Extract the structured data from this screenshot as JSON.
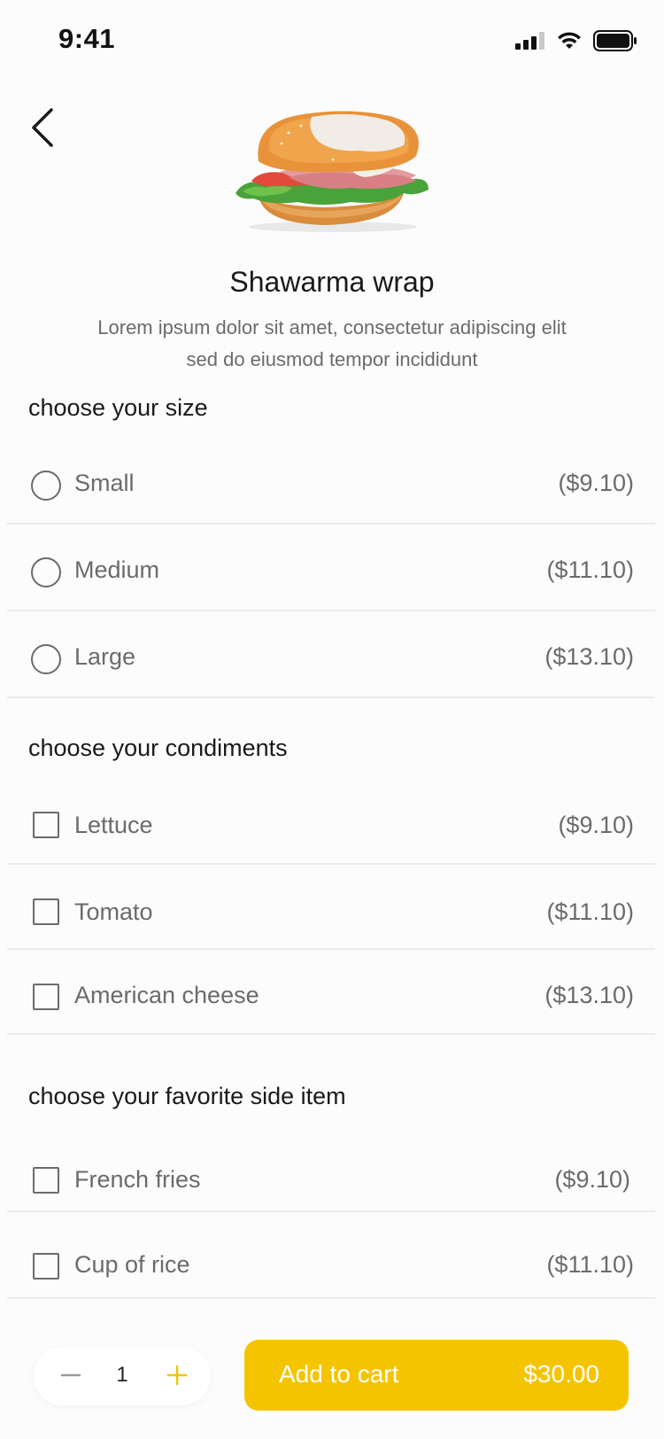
{
  "status_bar": {
    "time": "9:41"
  },
  "product": {
    "name": "Shawarma wrap",
    "description_line1": "Lorem ipsum dolor sit amet, consectetur adipiscing elit",
    "description_line2": "sed do eiusmod tempor incididunt"
  },
  "sections": {
    "size": {
      "title": "choose your size",
      "options": [
        {
          "label": "Small",
          "price": "($9.10)"
        },
        {
          "label": "Medium",
          "price": "($11.10)"
        },
        {
          "label": "Large",
          "price": "($13.10)"
        }
      ]
    },
    "condiments": {
      "title": "choose your condiments",
      "options": [
        {
          "label": "Lettuce",
          "price": "($9.10)"
        },
        {
          "label": "Tomato",
          "price": "($11.10)"
        },
        {
          "label": "American cheese",
          "price": "($13.10)"
        }
      ]
    },
    "sides": {
      "title": "choose your favorite side item",
      "options": [
        {
          "label": "French fries",
          "price": "($9.10)"
        },
        {
          "label": "Cup of rice",
          "price": "($11.10)"
        }
      ]
    }
  },
  "cart": {
    "quantity": "1",
    "add_label": "Add to cart",
    "total": "$30.00"
  },
  "colors": {
    "accent": "#f5c400",
    "text_primary": "#1a1a1a",
    "text_secondary": "#6b6b6b"
  }
}
